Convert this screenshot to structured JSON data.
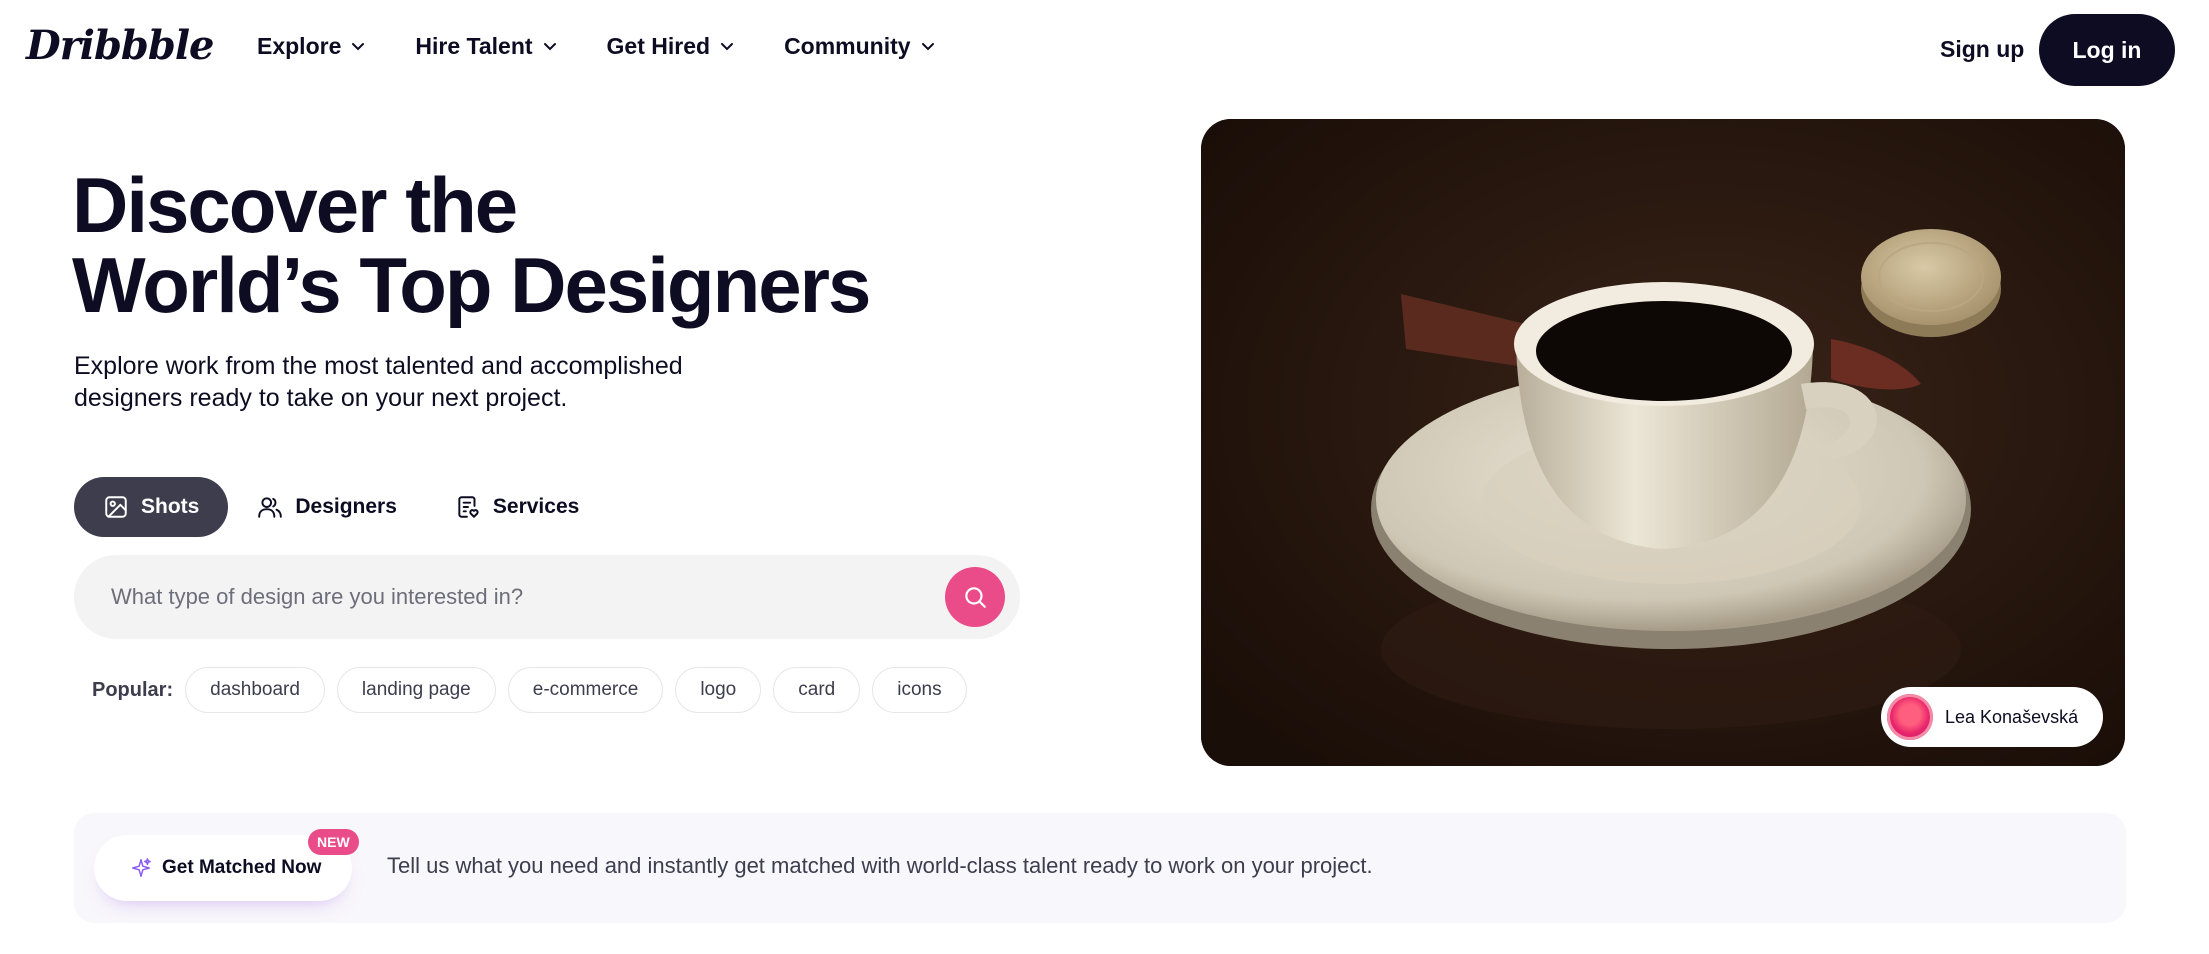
{
  "header": {
    "logo": "Dribbble",
    "nav": [
      {
        "label": "Explore"
      },
      {
        "label": "Hire Talent"
      },
      {
        "label": "Get Hired"
      },
      {
        "label": "Community"
      }
    ],
    "signup_label": "Sign up",
    "login_label": "Log in"
  },
  "hero": {
    "title_line1": "Discover the",
    "title_line2": "World’s Top Designers",
    "subtitle": "Explore work from the most talented and accomplished designers ready to take on your next project.",
    "tabs": [
      {
        "label": "Shots",
        "icon": "image-icon",
        "active": true
      },
      {
        "label": "Designers",
        "icon": "users-icon",
        "active": false
      },
      {
        "label": "Services",
        "icon": "service-list-icon",
        "active": false
      }
    ],
    "search": {
      "placeholder": "What type of design are you interested in?"
    },
    "popular": {
      "label": "Popular:",
      "tags": [
        "dashboard",
        "landing page",
        "e-commerce",
        "logo",
        "card",
        "icons"
      ]
    }
  },
  "media": {
    "credit_name": "Lea Konaševská"
  },
  "banner": {
    "button_label": "Get Matched Now",
    "badge": "NEW",
    "text": "Tell us what you need and instantly get matched with world-class talent ready to work on your project."
  },
  "colors": {
    "brand_pink": "#ea4c89",
    "dark": "#0d0c22",
    "tab_active": "#3d3d4e"
  }
}
